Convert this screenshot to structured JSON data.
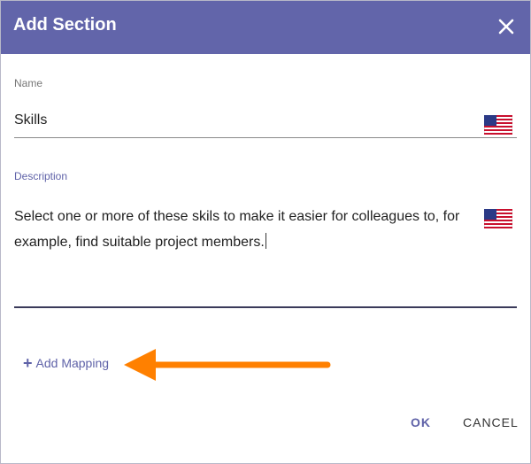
{
  "dialog": {
    "title": "Add Section",
    "header_color": "#6265aa",
    "close_icon": "close-icon"
  },
  "name_field": {
    "label": "Name",
    "value": "Skills",
    "language_icon": "us-flag-icon"
  },
  "description_field": {
    "label": "Description",
    "value": "Select one or more of these skils to make it easier for colleagues to, for example, find suitable project members.",
    "language_icon": "us-flag-icon"
  },
  "add_mapping": {
    "icon": "plus-icon",
    "label": "Add Mapping",
    "annotation_color": "#ff8000"
  },
  "actions": {
    "ok_label": "OK",
    "cancel_label": "CANCEL"
  }
}
